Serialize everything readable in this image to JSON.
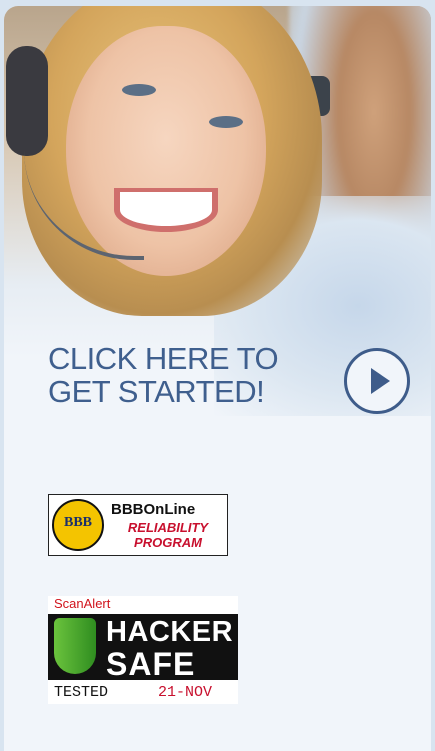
{
  "cta": {
    "line1": "CLICK HERE TO",
    "line2": "GET STARTED!",
    "button_icon": "play-arrow-icon"
  },
  "badges": {
    "bbb": {
      "seal_text": "BBB",
      "title": "BBBOnLine",
      "line1": "RELIABILITY",
      "line2": "PROGRAM"
    },
    "hacker_safe": {
      "brand": "ScanAlert",
      "word1": "HACKER",
      "word2": "SAFE",
      "tested": "TESTED",
      "date": "21-NOV"
    }
  },
  "colors": {
    "accent": "#3f5f8e",
    "panel": "#f1f5fa",
    "bbb_red": "#c8102e",
    "bbb_yellow": "#f4c400"
  }
}
